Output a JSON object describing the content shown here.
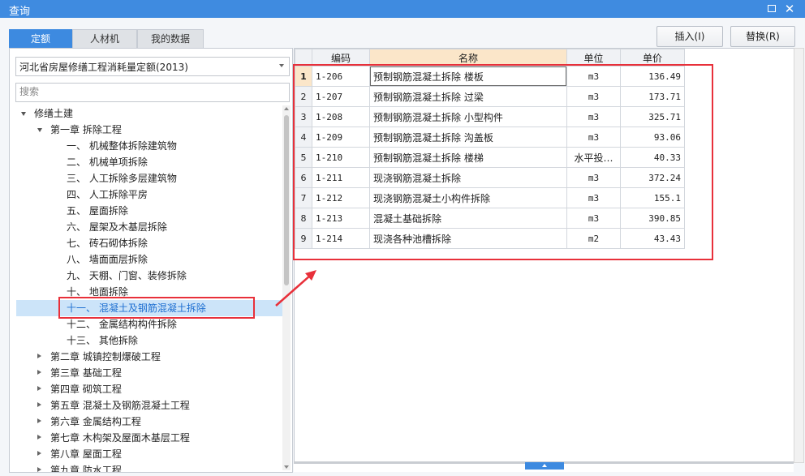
{
  "window": {
    "title": "查询",
    "maximize_label": "",
    "close_label": "✕"
  },
  "tabs": [
    {
      "label": "定额",
      "active": true
    },
    {
      "label": "人材机",
      "active": false
    },
    {
      "label": "我的数据",
      "active": false
    }
  ],
  "toolbar": {
    "insert_label": "插入(I)",
    "replace_label": "替换(R)"
  },
  "left": {
    "quota_select": {
      "value": "河北省房屋修缮工程消耗量定额(2013)"
    },
    "search": {
      "placeholder": "搜索"
    },
    "tree": [
      {
        "label": "修缮土建",
        "level": 0,
        "expander": "down"
      },
      {
        "label": "第一章 拆除工程",
        "level": 1,
        "expander": "down"
      },
      {
        "label": "一、 机械整体拆除建筑物",
        "level": 2
      },
      {
        "label": "二、 机械单项拆除",
        "level": 2
      },
      {
        "label": "三、 人工拆除多层建筑物",
        "level": 2
      },
      {
        "label": "四、 人工拆除平房",
        "level": 2
      },
      {
        "label": "五、 屋面拆除",
        "level": 2
      },
      {
        "label": "六、 屋架及木基层拆除",
        "level": 2
      },
      {
        "label": "七、 砖石砌体拆除",
        "level": 2
      },
      {
        "label": "八、 墙面面层拆除",
        "level": 2
      },
      {
        "label": "九、 天棚、门窗、装修拆除",
        "level": 2
      },
      {
        "label": "十、 地面拆除",
        "level": 2
      },
      {
        "label": "十一、 混凝土及钢筋混凝土拆除",
        "level": 2,
        "selected": true
      },
      {
        "label": "十二、 金属结构构件拆除",
        "level": 2
      },
      {
        "label": "十三、 其他拆除",
        "level": 2
      },
      {
        "label": "第二章 城镇控制爆破工程",
        "level": 1,
        "expander": "right"
      },
      {
        "label": "第三章 基础工程",
        "level": 1,
        "expander": "right"
      },
      {
        "label": "第四章 砌筑工程",
        "level": 1,
        "expander": "right"
      },
      {
        "label": "第五章 混凝土及钢筋混凝土工程",
        "level": 1,
        "expander": "right"
      },
      {
        "label": "第六章 金属结构工程",
        "level": 1,
        "expander": "right"
      },
      {
        "label": "第七章 木构架及屋面木基层工程",
        "level": 1,
        "expander": "right"
      },
      {
        "label": "第八章 屋面工程",
        "level": 1,
        "expander": "right"
      },
      {
        "label": "第九章 防水工程",
        "level": 1,
        "expander": "right"
      }
    ]
  },
  "table": {
    "columns": [
      "编码",
      "名称",
      "单位",
      "单价"
    ],
    "rows": [
      {
        "no": "1",
        "code": "1-206",
        "name": "预制钢筋混凝土拆除 楼板",
        "unit": "m3",
        "price": "136.49",
        "current": true
      },
      {
        "no": "2",
        "code": "1-207",
        "name": "预制钢筋混凝土拆除 过梁",
        "unit": "m3",
        "price": "173.71"
      },
      {
        "no": "3",
        "code": "1-208",
        "name": "预制钢筋混凝土拆除 小型构件",
        "unit": "m3",
        "price": "325.71"
      },
      {
        "no": "4",
        "code": "1-209",
        "name": "预制钢筋混凝土拆除 沟盖板",
        "unit": "m3",
        "price": "93.06"
      },
      {
        "no": "5",
        "code": "1-210",
        "name": "预制钢筋混凝土拆除 楼梯",
        "unit": "水平投…",
        "price": "40.33"
      },
      {
        "no": "6",
        "code": "1-211",
        "name": "现浇钢筋混凝土拆除",
        "unit": "m3",
        "price": "372.24"
      },
      {
        "no": "7",
        "code": "1-212",
        "name": "现浇钢筋混凝土小构件拆除",
        "unit": "m3",
        "price": "155.1"
      },
      {
        "no": "8",
        "code": "1-213",
        "name": "混凝土基础拆除",
        "unit": "m3",
        "price": "390.85"
      },
      {
        "no": "9",
        "code": "1-214",
        "name": "现浇各种池槽拆除",
        "unit": "m2",
        "price": "43.43"
      }
    ]
  },
  "colors": {
    "title_bar": "#3f8be0",
    "active_tab": "#3d8ae0",
    "annotation_red": "#e8303a",
    "selected_item_text": "#1e6fd1",
    "selected_row_bg": "#cce4f9",
    "name_header_highlight": "#fbe6c9"
  }
}
